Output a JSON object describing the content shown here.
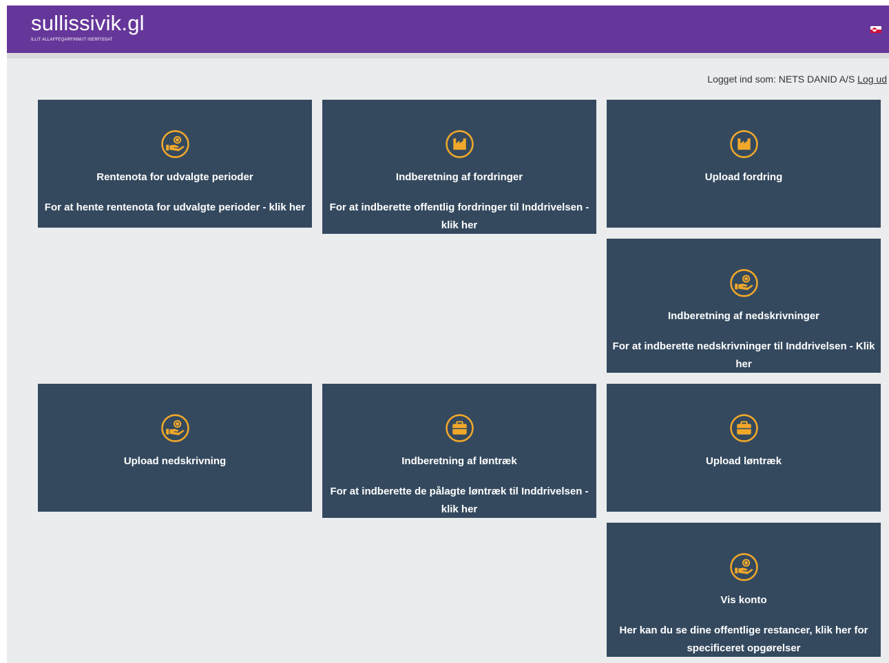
{
  "header": {
    "logo": "sullissivik.gl",
    "tagline": "ILLIT ALLAFFEQARFINNUT ISERFISSAT",
    "language_flag": "greenland-flag-icon"
  },
  "login": {
    "text": "Logget ind som: NETS DANID A/S",
    "logout_label": "Log ud"
  },
  "colors": {
    "header": "#66379a",
    "tile": "#34495e",
    "icon_accent": "#f0a82a",
    "background": "#ebecee"
  },
  "tiles": [
    {
      "icon": "hand-coin-icon",
      "title": "Rentenota for udvalgte perioder",
      "description": "For at hente rentenota for udvalgte perioder - klik her"
    },
    {
      "icon": "factory-icon",
      "title": "Indberetning af fordringer",
      "description": "For at indberette offentlig fordringer til Inddrivelsen - klik her"
    },
    {
      "icon": "factory-icon",
      "title": "Upload fordring",
      "description": ""
    },
    {
      "icon": "hand-coin-icon",
      "title": "Indberetning af nedskrivninger",
      "description": "For at indberette nedskrivninger til Inddrivelsen - Klik her"
    },
    {
      "icon": "hand-coin-icon",
      "title": "Upload nedskrivning",
      "description": ""
    },
    {
      "icon": "briefcase-icon",
      "title": "Indberetning af løntræk",
      "description": "For at indberette de pålagte løntræk til Inddrivelsen - klik her"
    },
    {
      "icon": "briefcase-icon",
      "title": "Upload løntræk",
      "description": ""
    },
    {
      "icon": "hand-coin-icon",
      "title": "Vis konto",
      "description": "Her kan du se dine offentlige restancer, klik her for specificeret opgørelser"
    }
  ]
}
